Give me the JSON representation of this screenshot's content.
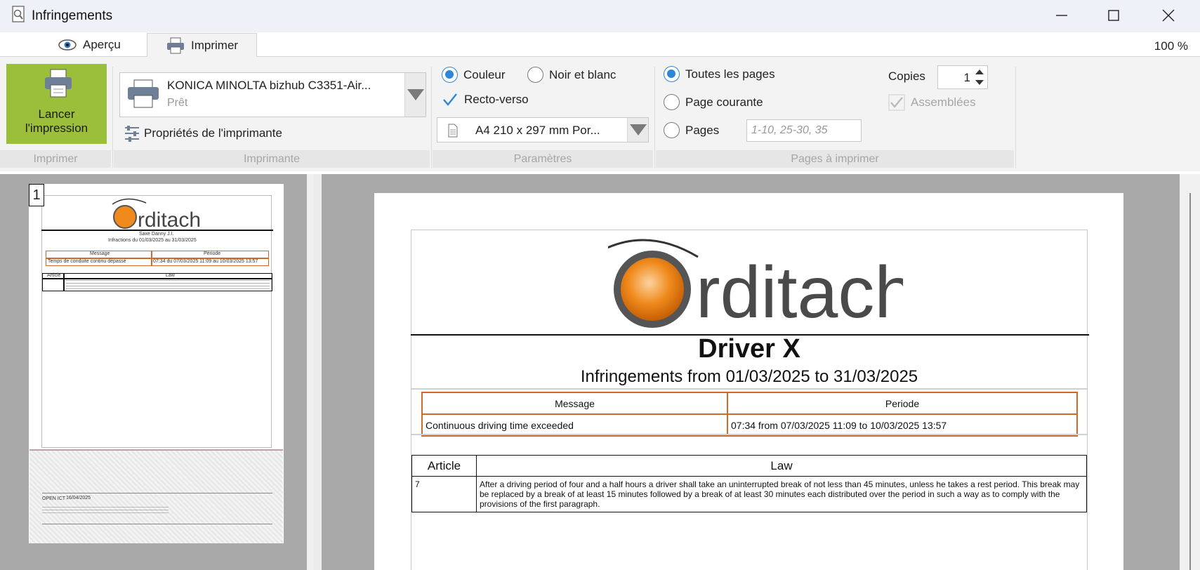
{
  "window": {
    "title": "Infringements"
  },
  "tabs": {
    "apercu": "Aperçu",
    "imprimer": "Imprimer"
  },
  "zoom": "100 %",
  "ribbon": {
    "print_button": {
      "line1": "Lancer",
      "line2": "l'impression"
    },
    "printer": {
      "name": "KONICA MINOLTA bizhub C3351-Air...",
      "status": "Prêt",
      "properties": "Propriétés de l'imprimante"
    },
    "params": {
      "color": "Couleur",
      "bw": "Noir et blanc",
      "duplex": "Recto-verso",
      "paper": "A4 210 x 297 mm Por..."
    },
    "pages": {
      "all": "Toutes les pages",
      "current": "Page courante",
      "range": "Pages",
      "range_placeholder": "1-10, 25-30, 35"
    },
    "copies": {
      "label": "Copies",
      "value": "1",
      "collate": "Assemblées"
    },
    "group_labels": {
      "print": "Imprimer",
      "printer": "Imprimante",
      "params": "Paramètres",
      "pages": "Pages à imprimer"
    }
  },
  "thumbnail": {
    "page_number": "1",
    "logo_text": "Orditach",
    "driver": "Saxe Danny J.I.",
    "period": "Infractions du 01/03/2025 au 31/03/2025",
    "col_message": "Message",
    "col_periode": "Période",
    "row_message": "Temps de conduite continu dépassé",
    "row_periode": "07:34 du 07/03/2025 11:09 au 10/03/2025 13:57",
    "col_article": "Article",
    "col_law": "Law",
    "footer_date_label": "OPEN ICT",
    "footer_date": "16/04/2025"
  },
  "document": {
    "logo_text": "rditach",
    "driver": "Driver X",
    "subtitle": "Infringements from 01/03/2025 to 31/03/2025",
    "infringements": {
      "headers": [
        "Message",
        "Periode"
      ],
      "rows": [
        [
          "Continuous driving time exceeded",
          "07:34 from 07/03/2025 11:09 to 10/03/2025 13:57"
        ]
      ]
    },
    "law": {
      "headers": [
        "Article",
        "Law"
      ],
      "rows": [
        [
          "7",
          "After a driving period of four and a half hours a driver shall take an uninterrupted break of not less than 45 minutes, unless he takes a rest period. This break may be replaced by a break of at least 15 minutes followed by a break of at least 30 minutes each distributed over the period in such a way as to comply with the provisions of the first paragraph."
        ]
      ]
    }
  },
  "colors": {
    "print_button": "#9bbf3a",
    "accent": "#2f86d6",
    "table_border": "#d06a2a",
    "orange": "#f08a1c"
  }
}
